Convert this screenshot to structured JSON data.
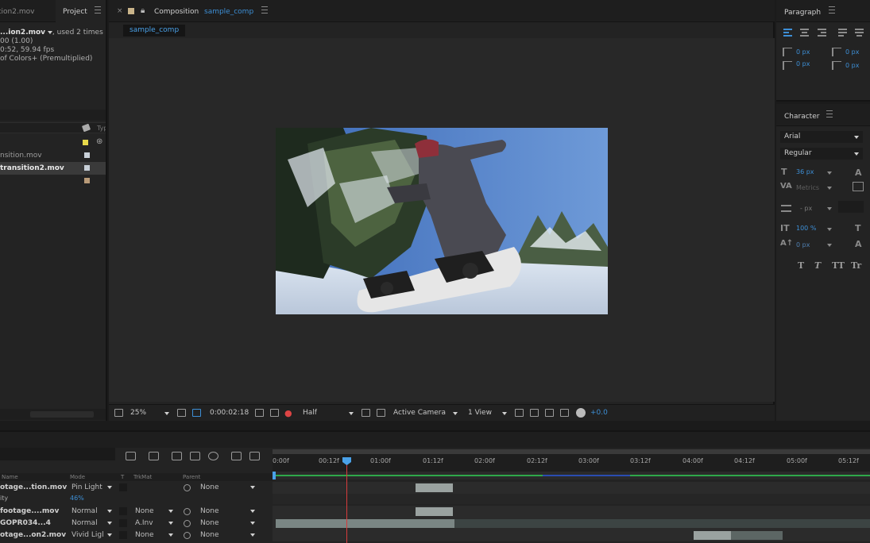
{
  "project": {
    "tab_left": "tion2.mov",
    "tab_project": "Project",
    "info_name": "...ion2.mov",
    "info_used": ", used 2 times",
    "info_line2": "00 (1.00)",
    "info_line3": "0:52, 59.94 fps",
    "info_line4": "of Colors+ (Premultiplied)",
    "col_type": "Typ",
    "items": [
      {
        "name": "nsition.mov",
        "swatch": "#c8d0d8",
        "selected": false
      },
      {
        "name": "transition2.mov",
        "swatch": "#c8d0d8",
        "selected": true
      },
      {
        "name": "",
        "swatch": "#b89a78",
        "selected": false
      }
    ],
    "top_swatch": "#e6d84a"
  },
  "composition": {
    "tab_label": "Composition",
    "tab_name": "sample_comp",
    "sub_tab": "sample_comp",
    "toolbar": {
      "zoom": "25%",
      "timecode": "0:00:02:18",
      "resolution": "Half",
      "camera": "Active Camera",
      "views": "1 View",
      "exposure": "+0.0"
    }
  },
  "paragraph": {
    "title": "Paragraph",
    "indent_left": "0 px",
    "indent_right": "0 px",
    "space_before": "0 px",
    "space_after": "0 px"
  },
  "character": {
    "title": "Character",
    "font": "Arial",
    "style": "Regular",
    "size": "36 px",
    "kerning": "Metrics",
    "leading": "- px",
    "vscale": "100 %",
    "baseline": "0 px",
    "style_buttons": [
      "T",
      "T",
      "TT",
      "Tr"
    ]
  },
  "timeline": {
    "col_name": "Name",
    "col_mode": "Mode",
    "col_t": "T",
    "col_trkmat": "TrkMat",
    "col_parent": "Parent",
    "ruler_ticks": [
      "0:00f",
      "00:12f",
      "01:00f",
      "01:12f",
      "02:00f",
      "02:12f",
      "03:00f",
      "03:12f",
      "04:00f",
      "04:12f",
      "05:00f",
      "05:12f"
    ],
    "opacity_label": "ity",
    "opacity_value": "46%",
    "layers": [
      {
        "name": "otage...tion.mov",
        "mode": "Pin Light",
        "trkmat": "",
        "parent": "None"
      },
      {
        "name": "footage....mov",
        "mode": "Normal",
        "trkmat": "None",
        "parent": "None"
      },
      {
        "name": "GOPR034...4",
        "mode": "Normal",
        "trkmat": "A.Inv",
        "parent": "None"
      },
      {
        "name": "otage...on2.mov",
        "mode": "Vivid Ligl",
        "trkmat": "None",
        "parent": "None"
      }
    ]
  }
}
